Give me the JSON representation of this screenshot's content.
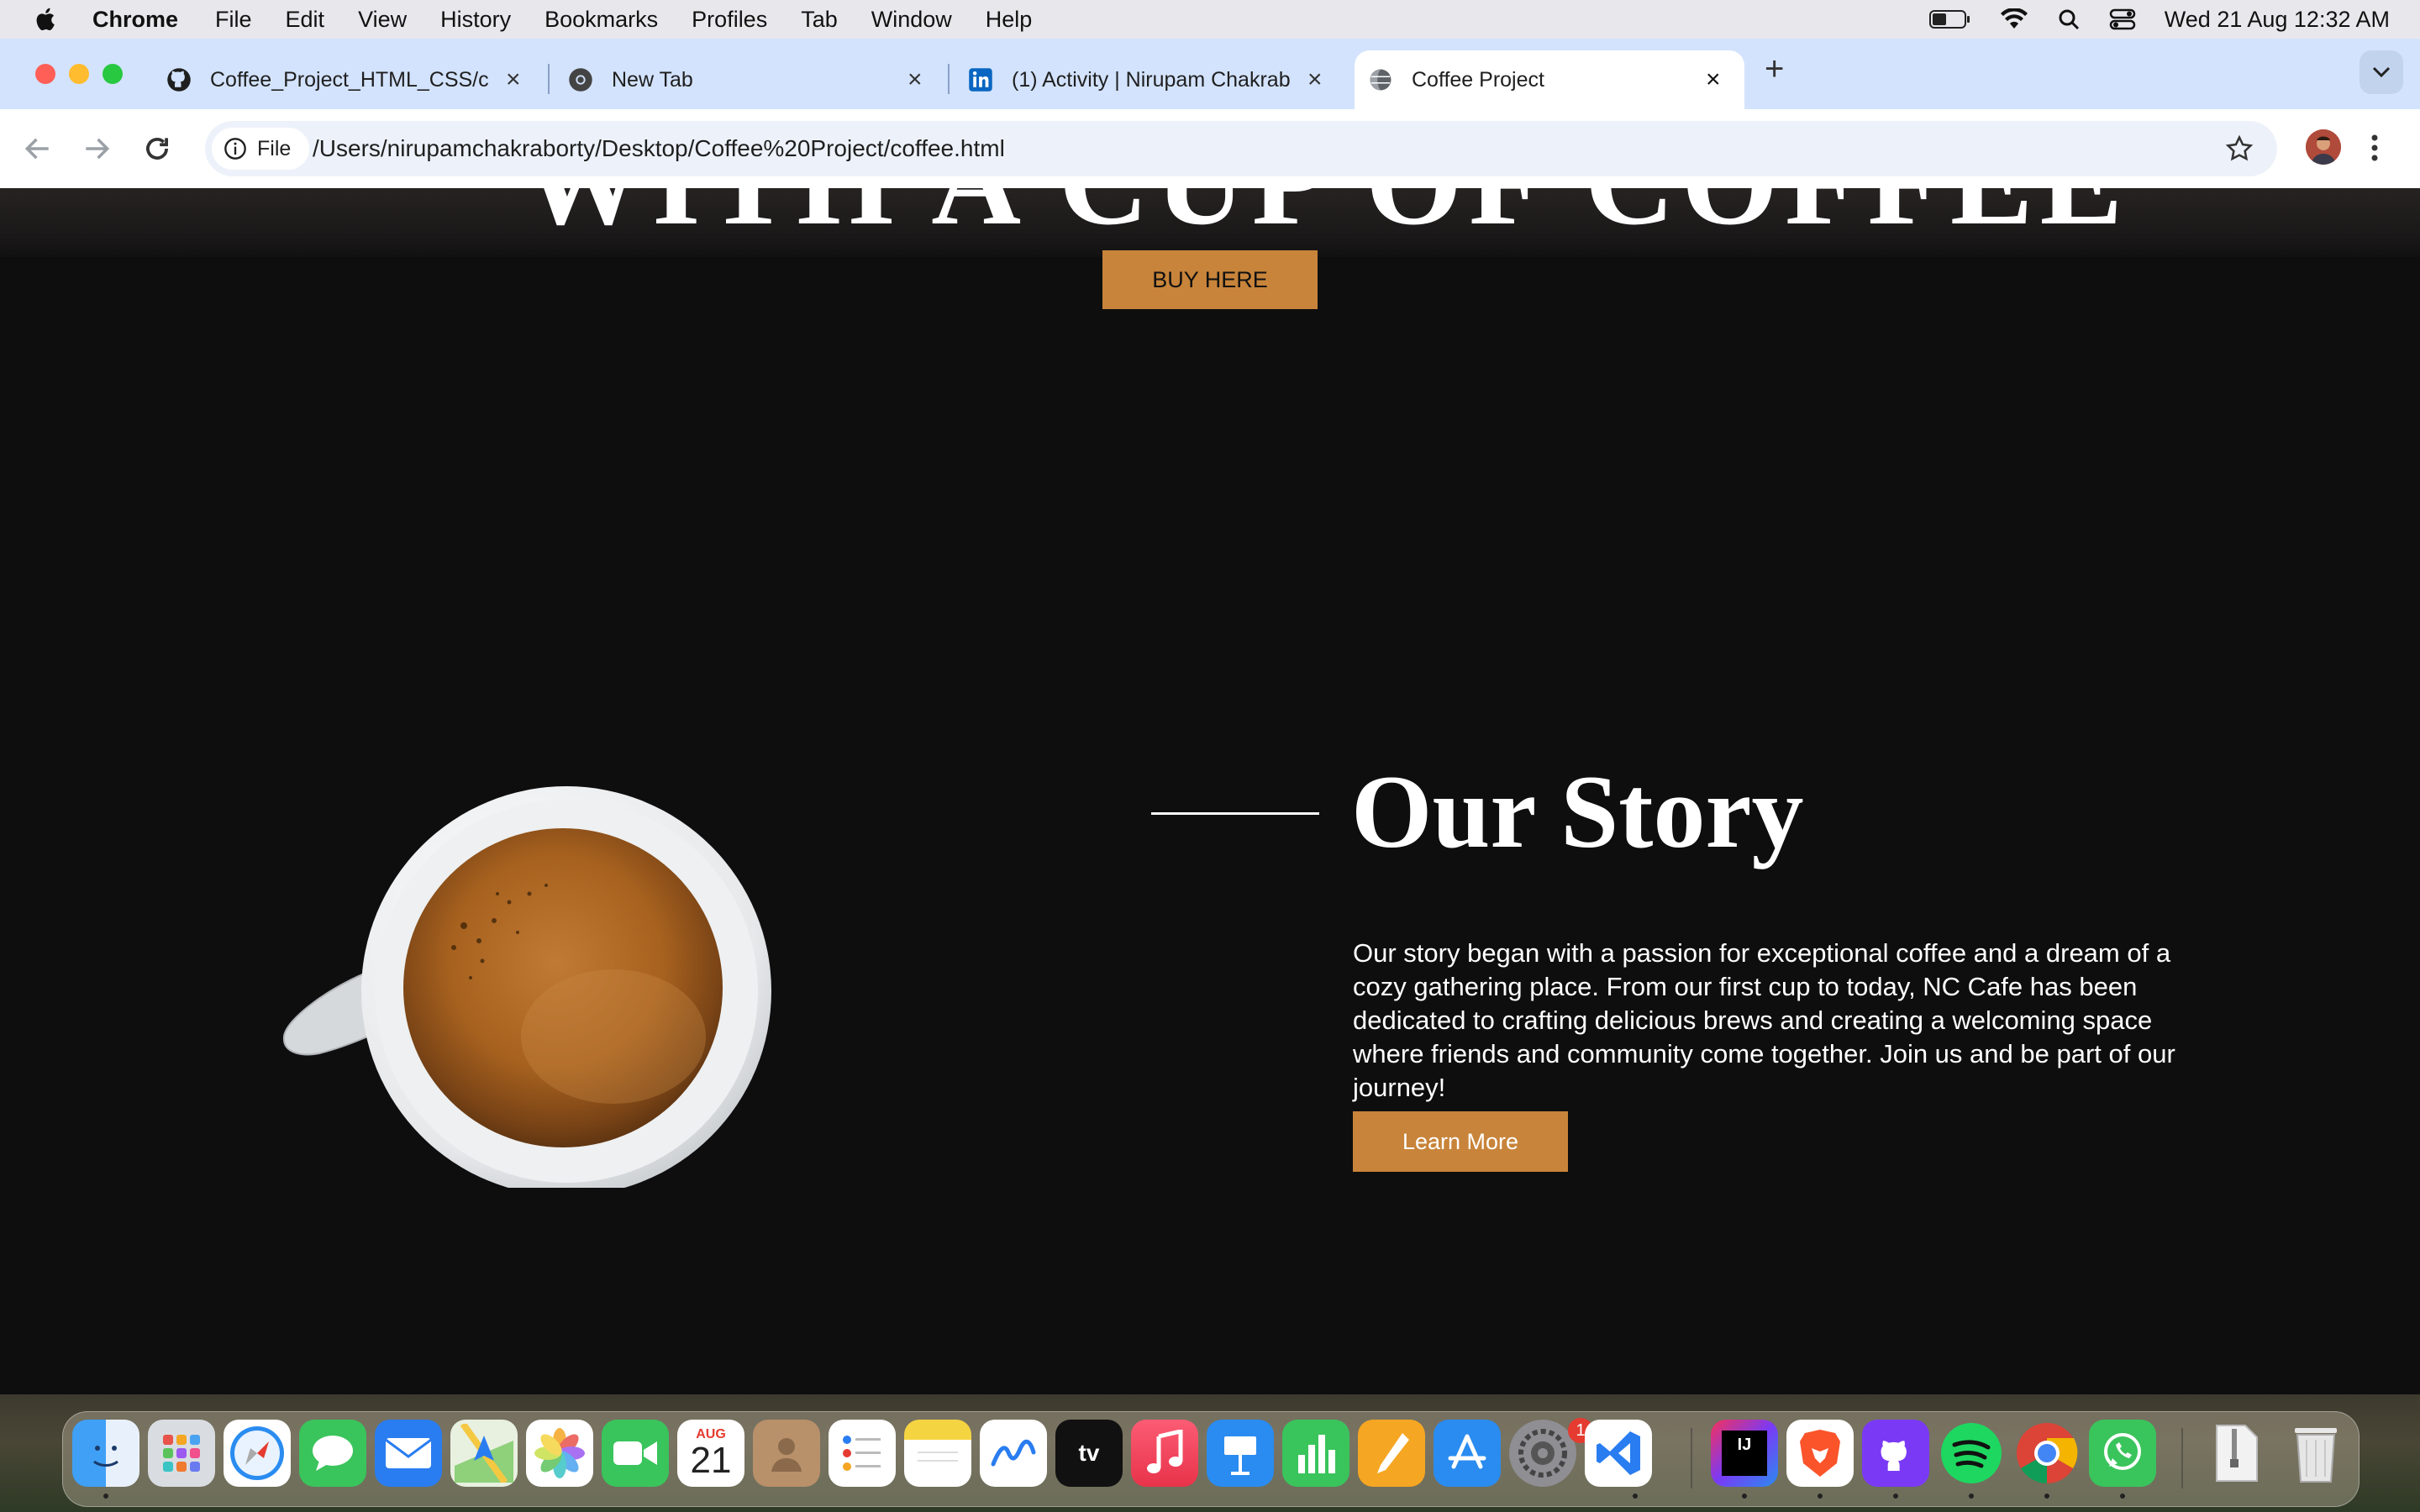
{
  "menubar": {
    "app": "Chrome",
    "items": [
      "File",
      "Edit",
      "View",
      "History",
      "Bookmarks",
      "Profiles",
      "Tab",
      "Window",
      "Help"
    ],
    "datetime": "Wed 21 Aug  12:32 AM"
  },
  "tabs": [
    {
      "title": "Coffee_Project_HTML_CSS/c",
      "icon": "github-icon"
    },
    {
      "title": "New Tab",
      "icon": "chrome-icon"
    },
    {
      "title": "(1) Activity | Nirupam Chakrab",
      "icon": "linkedin-icon"
    },
    {
      "title": "Coffee Project",
      "icon": "globe-icon",
      "active": true
    }
  ],
  "toolbar": {
    "chip_label": "File",
    "url": "/Users/nirupamchakraborty/Desktop/Coffee%20Project/coffee.html"
  },
  "page": {
    "hero_title": "WITH A CUP OF COFFEE",
    "buy_button": "BUY HERE",
    "story_title": "Our Story",
    "story_text": "Our story began with a passion for exceptional coffee and a dream of a cozy gathering place. From our first cup to today, NC Cafe has been dedicated to crafting delicious brews and creating a welcoming space where friends and community come together. Join us and be part of our journey!",
    "learn_more": "Learn More"
  },
  "dock": {
    "apps": [
      "finder-icon",
      "launchpad-icon",
      "safari-icon",
      "messages-icon",
      "mail-icon",
      "maps-icon",
      "photos-icon",
      "facetime-icon",
      "calendar-icon",
      "contacts-icon",
      "reminders-icon",
      "notes-icon",
      "freeform-icon",
      "apple-tv-icon",
      "music-icon",
      "keynote-icon",
      "numbers-icon",
      "pages-icon",
      "app-store-icon",
      "system-settings-icon",
      "vscode-icon",
      "intellij-icon",
      "brave-icon",
      "github-desktop-icon",
      "spotify-icon",
      "chrome-icon",
      "whatsapp-icon",
      "archive-icon",
      "trash-icon"
    ],
    "calendar_month": "AUG",
    "calendar_day": "21",
    "settings_badge": "1"
  },
  "colors": {
    "accent": "#c8843a",
    "page_bg": "#0f0e0f",
    "tabstrip_bg": "#d3e3fd"
  }
}
